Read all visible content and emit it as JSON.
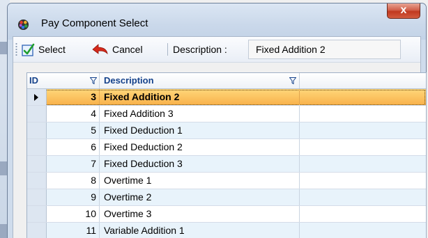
{
  "window": {
    "title": "Pay Component Select",
    "close_label": "x"
  },
  "toolbar": {
    "select_label": "Select",
    "cancel_label": "Cancel",
    "description_label": "Description :",
    "description_value": "Fixed Addition 2"
  },
  "grid": {
    "columns": [
      "ID",
      "Description"
    ],
    "rows": [
      {
        "id": "3",
        "description": "Fixed Addition 2",
        "selected": true
      },
      {
        "id": "4",
        "description": "Fixed Addition 3"
      },
      {
        "id": "5",
        "description": "Fixed Deduction 1"
      },
      {
        "id": "6",
        "description": "Fixed Deduction 2"
      },
      {
        "id": "7",
        "description": "Fixed Deduction 3"
      },
      {
        "id": "8",
        "description": "Overtime 1"
      },
      {
        "id": "9",
        "description": "Overtime 2"
      },
      {
        "id": "10",
        "description": "Overtime 3"
      },
      {
        "id": "11",
        "description": "Variable Addition 1"
      }
    ]
  },
  "colors": {
    "selected_row": "#f8b14a",
    "alt_row": "#e8f3fb",
    "header_text": "#15428b"
  },
  "icons": {
    "select": "checkmark-icon",
    "cancel": "back-arrow-icon",
    "filter": "funnel-icon",
    "app": "palette-icon"
  }
}
